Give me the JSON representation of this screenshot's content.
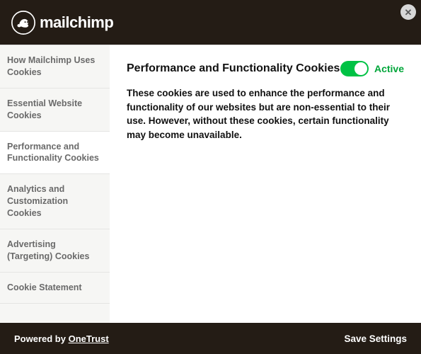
{
  "header": {
    "brand": "mailchimp"
  },
  "sidebar": {
    "items": [
      {
        "label": "How Mailchimp Uses Cookies"
      },
      {
        "label": "Essential Website Cookies"
      },
      {
        "label": "Performance and Functionality Cookies"
      },
      {
        "label": "Analytics and Customization Cookies"
      },
      {
        "label": "Advertising (Targeting) Cookies"
      },
      {
        "label": "Cookie Statement"
      }
    ]
  },
  "content": {
    "title": "Performance and Functionality Cookies",
    "toggle_state": "Active",
    "description": "These cookies are used to enhance the performance and functionality of our websites but are non-essential to their use. However, without these cookies, certain functionality may become unavailable."
  },
  "footer": {
    "powered_prefix": "Powered by ",
    "powered_link": "OneTrust",
    "save": "Save Settings"
  }
}
